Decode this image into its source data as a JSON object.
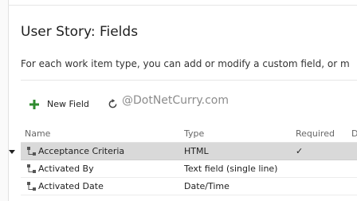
{
  "page": {
    "title": "User Story: Fields",
    "description": "For each work item type, you can add or modify a custom field, or m"
  },
  "toolbar": {
    "new_field_label": "New Field",
    "new_field_icon": "plus-icon",
    "refresh_icon": "refresh-icon",
    "accent_color": "#2e8b2e"
  },
  "watermark": "@DotNetCurry.com",
  "grid": {
    "columns": {
      "name": "Name",
      "type": "Type",
      "required": "Required",
      "extra": "D"
    },
    "rows": [
      {
        "name": "Acceptance Criteria",
        "type": "HTML",
        "required": "✓",
        "selected": true
      },
      {
        "name": "Activated By",
        "type": "Text field (single line)",
        "required": "",
        "selected": false
      },
      {
        "name": "Activated Date",
        "type": "Date/Time",
        "required": "",
        "selected": false
      }
    ],
    "selected_row_color": "#d9d9d9"
  }
}
